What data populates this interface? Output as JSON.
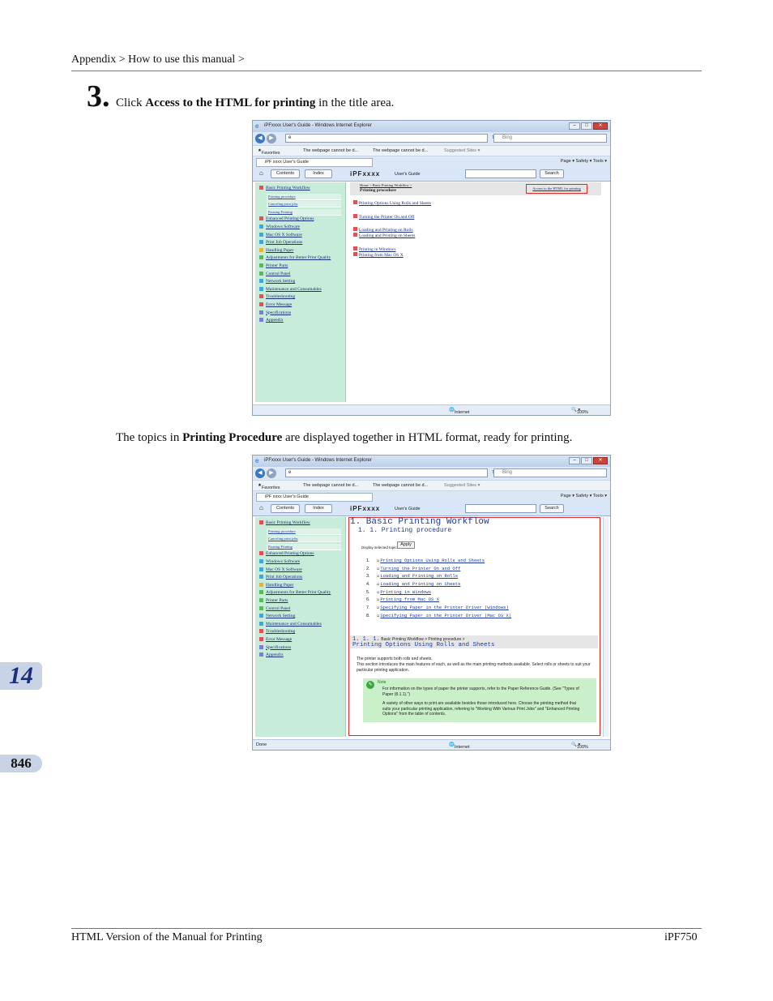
{
  "page": {
    "breadcrumb": "Appendix > How to use this manual >",
    "step_number": "3.",
    "step_pre": "Click ",
    "step_bold": "Access to the HTML for printing",
    "step_post": " in the title area.",
    "para_pre": "The topics in ",
    "para_bold": "Printing Procedure",
    "para_post": " are displayed together in HTML format, ready for printing.",
    "chapter_tab": "14",
    "page_number": "846",
    "footer_left": "HTML Version of the Manual for Printing",
    "footer_right": "iPF750"
  },
  "browser": {
    "window_title": "iPFxxxx  User's Guide - Windows Internet Explorer",
    "address_value": "e",
    "search_placeholder": "Bing",
    "favorites_label": "Favorites",
    "fav_item_1": "The webpage cannot be d...",
    "fav_item_2": "The webpage cannot be d...",
    "fav_item_3": "Suggested Sites ▾",
    "tab_label": "iPF xxxx  User's Guide",
    "cmd_bar": "Page ▾  Safety ▾  Tools ▾",
    "status_zone": "Internet",
    "zoom": "100%",
    "status_done": "Done"
  },
  "app": {
    "contents_button": "Contents",
    "index_button": "Index",
    "brand": "iPFxxxx",
    "users_guide": "User's Guide",
    "search_button": "Search",
    "sidebar": [
      {
        "label": "Basic Printing Workflow",
        "color": "#e0525a"
      },
      {
        "label": "Enhanced Printing Options",
        "color": "#e0525a"
      },
      {
        "label": "Windows Software",
        "color": "#3fa8d8"
      },
      {
        "label": "Mac OS X Software",
        "color": "#3fa8d8"
      },
      {
        "label": "Print Job Operations",
        "color": "#3fa8d8"
      },
      {
        "label": "Handling Paper",
        "color": "#e9b03a"
      },
      {
        "label": "Adjustments for Better Print Quality",
        "color": "#5cb85c"
      },
      {
        "label": "Printer Parts",
        "color": "#5cb85c"
      },
      {
        "label": "Control Panel",
        "color": "#5cb85c"
      },
      {
        "label": "Network Setting",
        "color": "#3fa8d8"
      },
      {
        "label": "Maintenance and Consumables",
        "color": "#3fa8d8"
      },
      {
        "label": "Troubleshooting",
        "color": "#e0525a"
      },
      {
        "label": "Error Message",
        "color": "#e0525a"
      },
      {
        "label": "Specifications",
        "color": "#7a7fd4"
      },
      {
        "label": "Appendix",
        "color": "#7a7fd4"
      }
    ],
    "sidebar_sub": [
      "Printing procedure",
      "Canceling print jobs",
      "Pausing Printing"
    ]
  },
  "shot1": {
    "crumb": "Home > Basic Printing Workflow >",
    "heading": "Printing procedure",
    "access_link": "Access to the HTML for printing",
    "links": [
      "Printing Options Using Rolls and Sheets",
      "Turning the Printer On and Off",
      "Loading and Printing on Rolls",
      "Loading and Printing on Sheets",
      "Printing in Windows",
      "Printing from Mac OS X"
    ]
  },
  "shot2": {
    "h1": "1. Basic Printing Workflow",
    "h2": "1. 1. Printing procedure",
    "display_label": "Display selected topics",
    "apply_button": "Apply",
    "topics": [
      "Printing Options Using Rolls and Sheets",
      "Turning the Printer On and Off",
      "Loading and Printing on Rolls",
      "Loading and Printing on Sheets",
      "Printing in Windows",
      "Printing from Mac OS X",
      "Specifying Paper in the Printer Driver (Windows)",
      "Specifying Paper in the Printer Driver (Mac OS X)"
    ],
    "sec_num": "1. 1. 1.",
    "sec_crumb": "Basic Printing Workflow > Printing procedure >",
    "sec_title": "Printing Options Using Rolls and Sheets",
    "body_1": "The printer supports both rolls and sheets.",
    "body_2": "This section introduces the main features of each, as well as the main printing methods available. Select rolls or sheets to suit your particular printing application.",
    "note_label": "Note",
    "note_1": "For information on the types of paper the printer supports, refer to the Paper Reference Guide.  (See \"Types of Paper (8.1.1).\")",
    "note_2": "A variety of other ways to print are available besides those introduced here. Choose the printing method that suits your particular printing application, referring to \"Working With Various Print Jobs\" and \"Enhanced Printing Options\" from the table of contents."
  }
}
